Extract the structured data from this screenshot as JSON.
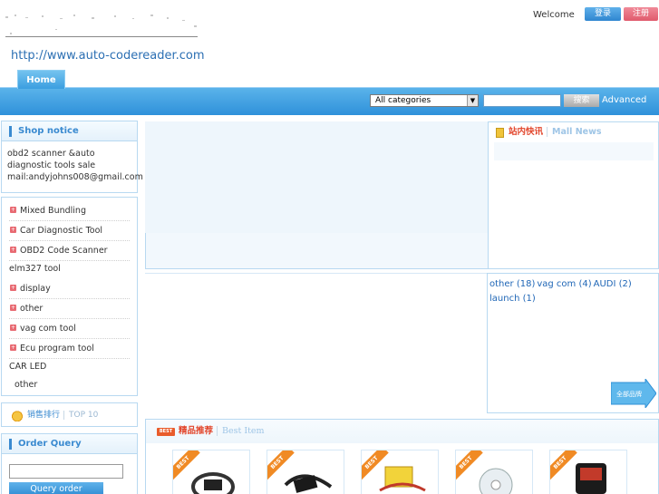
{
  "header": {
    "site_url": "http://www.auto-codereader.com",
    "welcome": "Welcome",
    "login_label": "登录",
    "register_label": "注册"
  },
  "nav": {
    "home_tab": "Home",
    "category_select": "All categories",
    "search_button": "搜索",
    "advanced_link": "Advanced"
  },
  "shop_notice": {
    "title": "Shop notice",
    "lines": [
      "obd2 scanner &auto",
      "diagnostic tools sale",
      "mail:andyjohns008@gmail.com"
    ]
  },
  "categories": {
    "items": [
      "Mixed Bundling",
      "Car Diagnostic Tool",
      "OBD2 Code Scanner",
      "elm327 tool",
      "display",
      "other",
      "vag com tool",
      "Ecu program tool",
      "CAR LED",
      "other"
    ]
  },
  "ranking": {
    "title": "销售排行",
    "subtitle": "TOP 10"
  },
  "order_query": {
    "title": "Order Query",
    "button": "Query order"
  },
  "mall_news": {
    "title_cn": "站内快讯",
    "title_en": "Mall News"
  },
  "brands": {
    "links": [
      "other (18)",
      "vag com (4)",
      "AUDI (2)",
      "launch (1)"
    ],
    "all_brands_button": "全部品牌"
  },
  "best_item": {
    "title_cn": "精品推荐",
    "title_en": "Best Item",
    "tag": "BEST",
    "ribbon": "BEST"
  },
  "colors": {
    "nav_blue": "#2f91da",
    "accent_blue": "#3a8ad0",
    "login_blue": "#2f86d0",
    "register_pink": "#e05a6c",
    "best_orange": "#f08a24"
  }
}
